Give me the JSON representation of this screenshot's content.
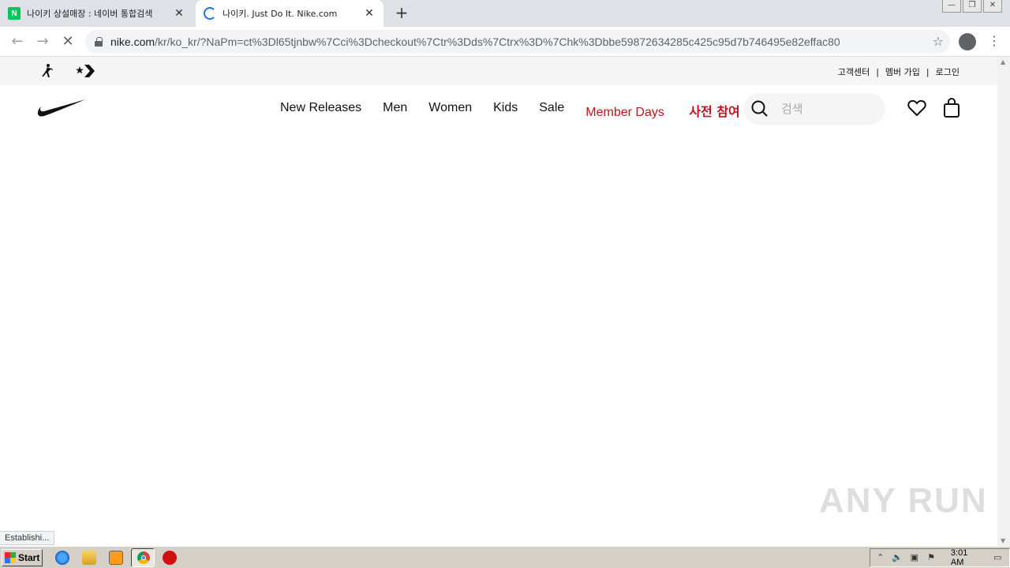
{
  "browser": {
    "tabs": [
      {
        "title": "나이키 상설매장 : 네이버 통합검색",
        "favicon": "naver-icon",
        "favicon_letter": "N",
        "active": false
      },
      {
        "title": "나이키. Just Do It. Nike.com",
        "favicon": "loading-spinner-icon",
        "active": true
      }
    ],
    "url_host": "nike.com",
    "url_path": "/kr/ko_kr/?NaPm=ct%3Dl65tjnbw%7Cci%3Dcheckout%7Ctr%3Dds%7Ctrx%3D%7Chk%3Dbbe59872634285c425c95d7b746495e82effac80",
    "status_text": "Establishi..."
  },
  "site": {
    "utility_links": [
      "고객센터",
      "멤버 가입",
      "로그인"
    ],
    "nav_items": [
      "New Releases",
      "Men",
      "Women",
      "Kids",
      "Sale"
    ],
    "member_days": {
      "prefix": "Member Days",
      "suffix": "사전 참여"
    },
    "search_placeholder": "검색"
  },
  "taskbar": {
    "start_label": "Start",
    "clock": "3:01 AM"
  },
  "watermark": "ANY RUN",
  "colors": {
    "member_days": "#c6101f",
    "naver_green": "#03c75a",
    "tabstrip": "#dee1e6"
  }
}
